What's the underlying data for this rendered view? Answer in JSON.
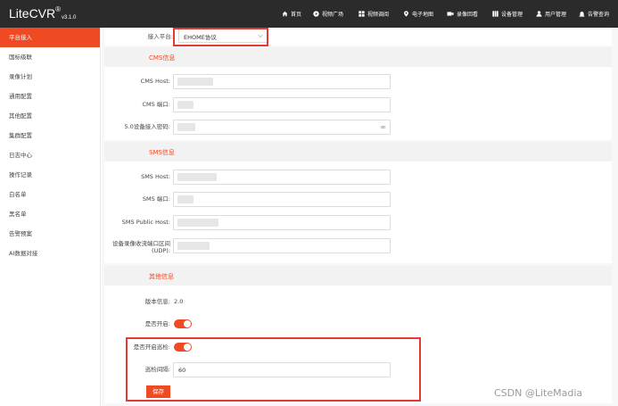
{
  "header": {
    "logo": "LiteCVR",
    "logo_mark": "®",
    "version": "v3.1.0",
    "nav": [
      {
        "label": "首页",
        "icon": "home-icon"
      },
      {
        "label": "视频广场",
        "icon": "play-circle-icon"
      },
      {
        "label": "视频调阅",
        "icon": "video-grid-icon"
      },
      {
        "label": "电子地图",
        "icon": "map-pin-icon"
      },
      {
        "label": "录像回看",
        "icon": "camera-icon"
      },
      {
        "label": "设备管理",
        "icon": "device-grid-icon"
      },
      {
        "label": "用户管理",
        "icon": "user-icon"
      },
      {
        "label": "告警查询",
        "icon": "alarm-icon"
      }
    ]
  },
  "sidebar": {
    "items": [
      "平台接入",
      "国标级联",
      "录像计划",
      "通用配置",
      "其他配置",
      "集群配置",
      "日志中心",
      "操作记录",
      "白名单",
      "黑名单",
      "告警预案",
      "AI数据对接"
    ]
  },
  "form": {
    "platform_label": "接入平台:",
    "platform_value": "EHOME协议",
    "cms_title": "CMS信息",
    "cms_host_label": "CMS Host:",
    "cms_port_label": "CMS 端口:",
    "cms_password_label": "5.0设备接入密码:",
    "sms_title": "SMS信息",
    "sms_host_label": "SMS Host:",
    "sms_port_label": "SMS 端口:",
    "sms_public_host_label": "SMS Public Host:",
    "udp_label_line1": "设备录像收流端口区间",
    "udp_label_line2": "(UDP):",
    "other_title": "其他信息",
    "version_label": "版本信息:",
    "version_value": "2.0",
    "enabled_label": "是否开启:",
    "patrol_label": "是否开启巡检:",
    "interval_label": "巡检间隔:",
    "interval_value": "60",
    "save_label": "保存"
  },
  "watermark": "CSDN @LiteMadia",
  "colors": {
    "accent": "#f04a24",
    "highlight_frame": "#e53935",
    "topbar": "#2b2b2b"
  }
}
